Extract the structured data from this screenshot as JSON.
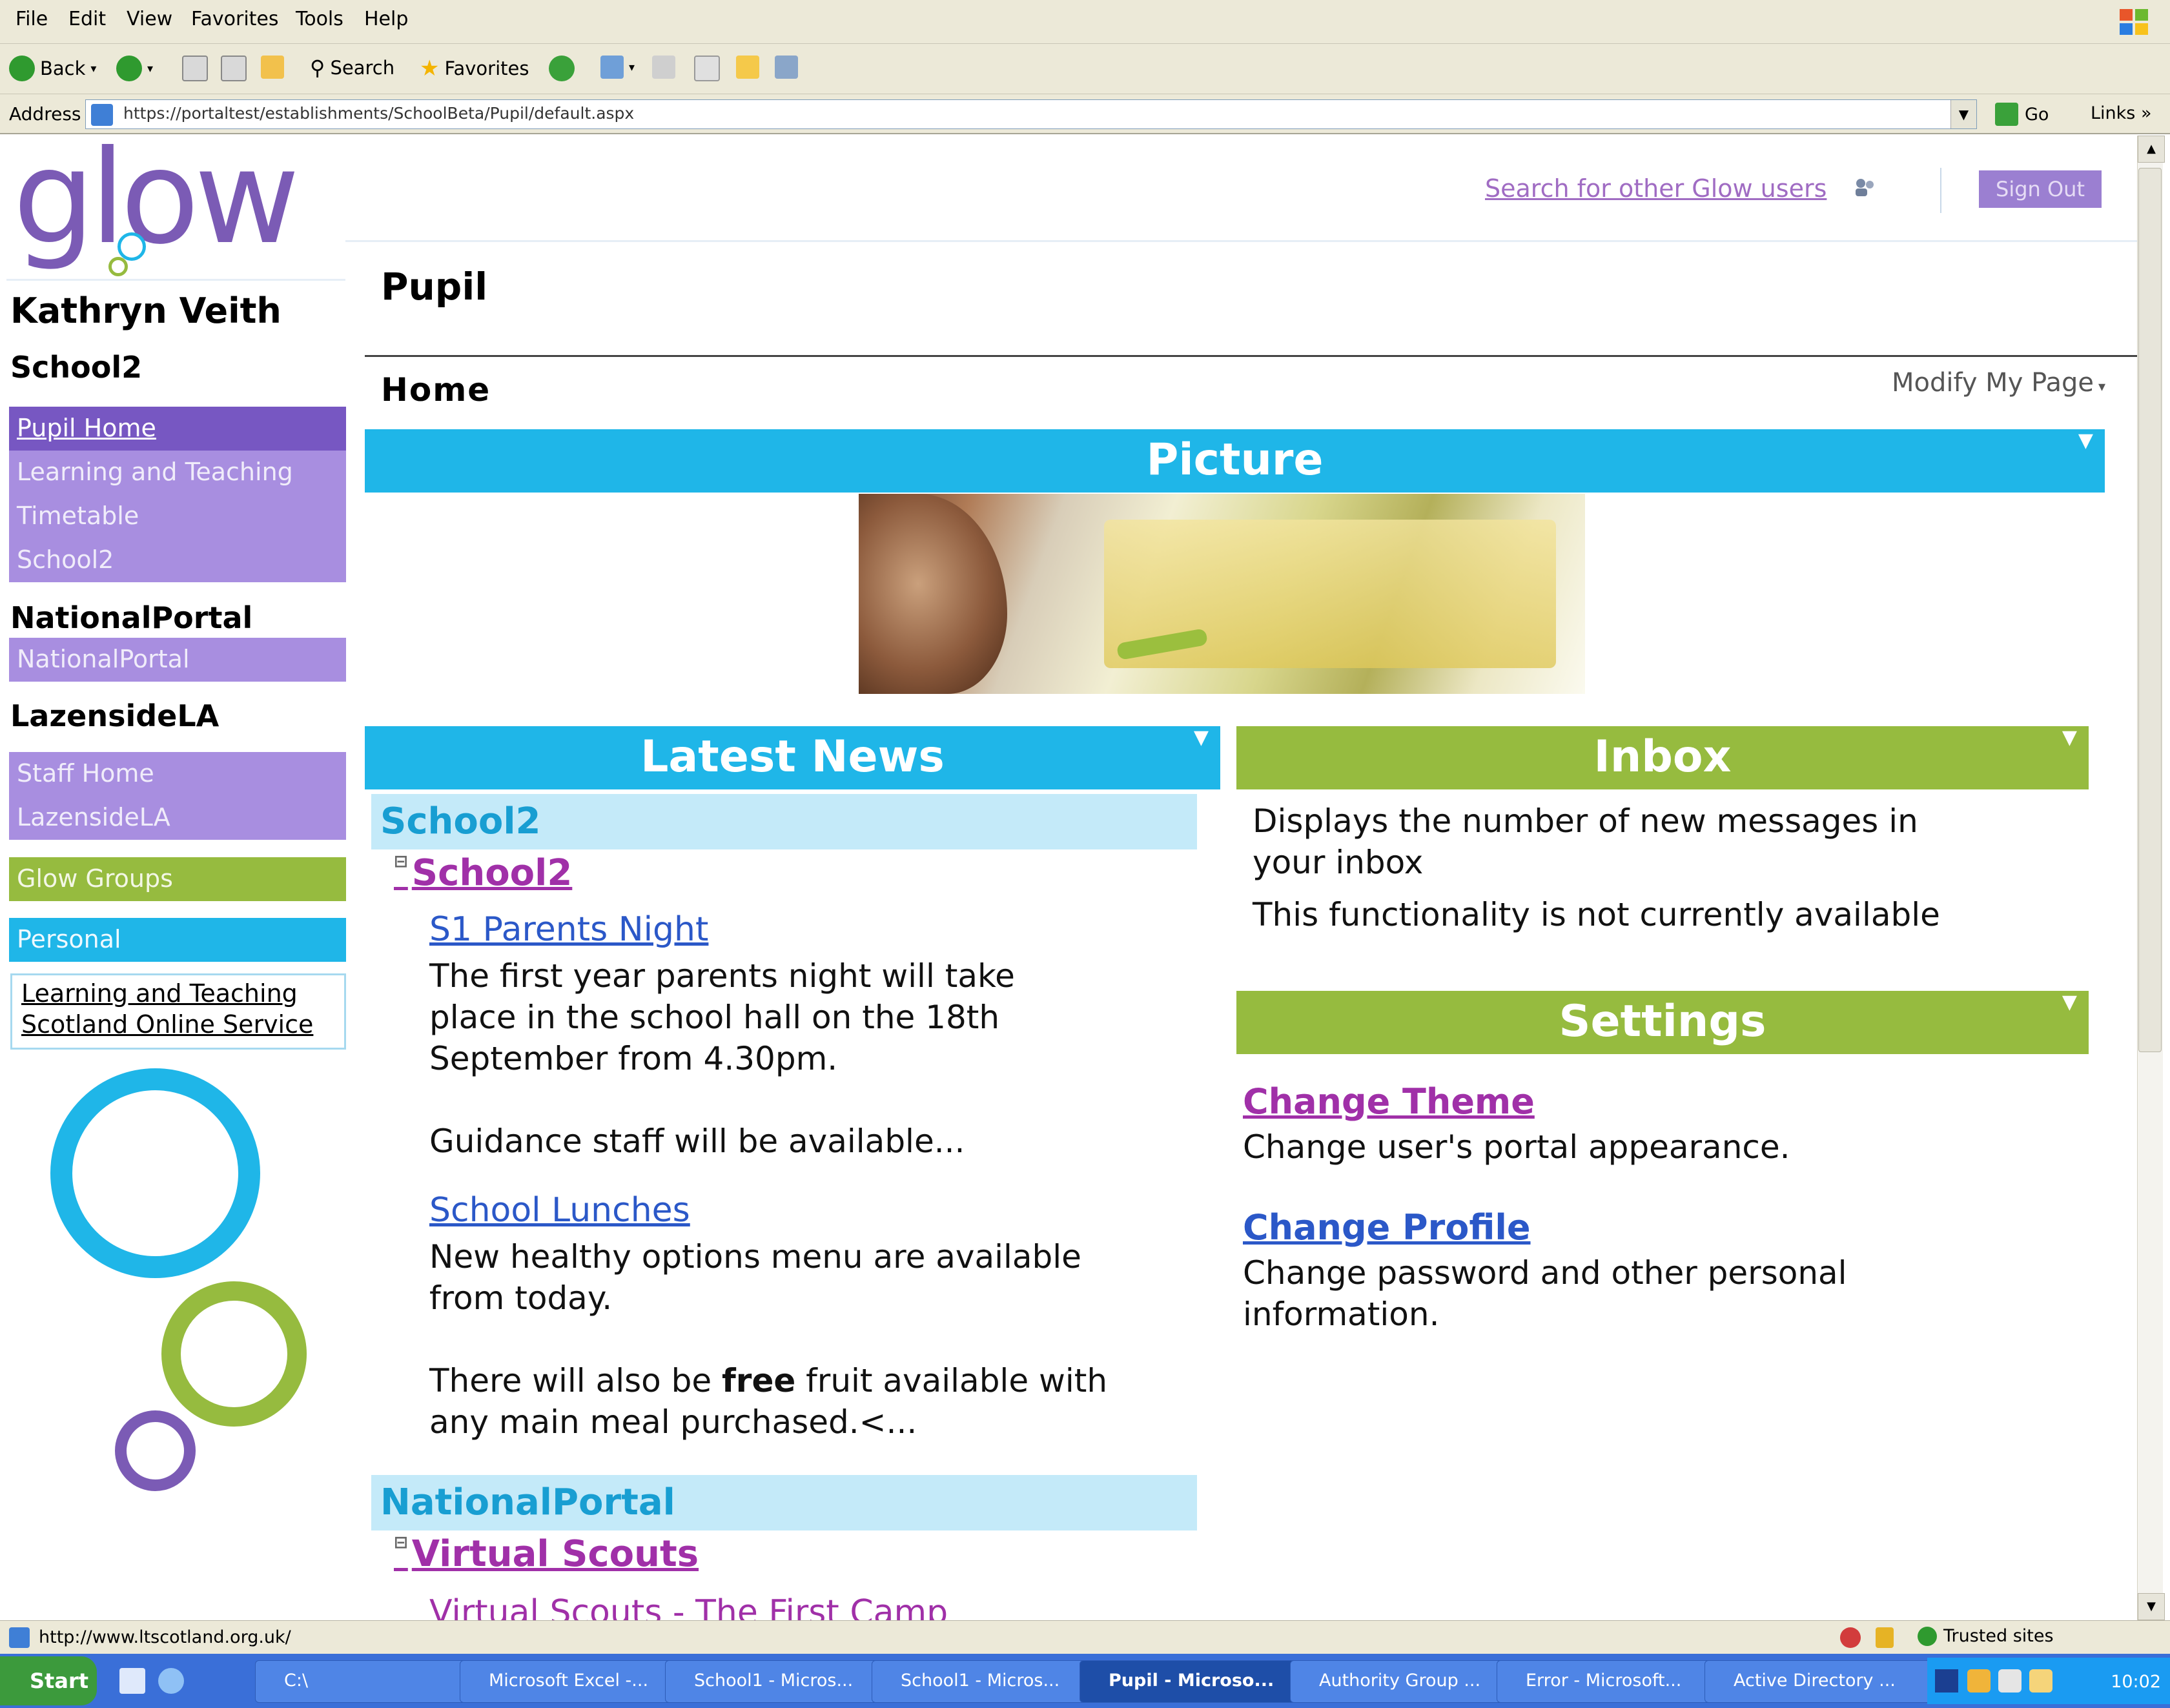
{
  "browser": {
    "menu": [
      "File",
      "Edit",
      "View",
      "Favorites",
      "Tools",
      "Help"
    ],
    "toolbar": {
      "back": "Back",
      "search": "Search",
      "favorites": "Favorites"
    },
    "address": {
      "label": "Address",
      "url": "https://portaltest/establishments/SchoolBeta/Pupil/default.aspx",
      "go": "Go",
      "links": "Links"
    },
    "status": {
      "url": "http://www.ltscotland.org.uk/",
      "zone": "Trusted sites"
    }
  },
  "header": {
    "logo": "glow",
    "search_users": "Search for other Glow users",
    "sign_out": "Sign Out"
  },
  "sidebar": {
    "user_name": "Kathryn Veith",
    "school": "School2",
    "school_items": [
      "Pupil Home",
      "Learning and Teaching",
      "Timetable",
      "School2"
    ],
    "national_heading": "NationalPortal",
    "national_items": [
      "NationalPortal"
    ],
    "la_heading": "LazensideLA",
    "la_items": [
      "Staff Home",
      "LazensideLA"
    ],
    "glow_groups": "Glow Groups",
    "personal": "Personal",
    "lts_line1": "Learning and Teaching",
    "lts_line2": "Scotland Online Service"
  },
  "main": {
    "title": "Pupil",
    "subtitle": "Home",
    "modify": "Modify My Page"
  },
  "picture": {
    "title": "Picture"
  },
  "news": {
    "title": "Latest News",
    "cat1": "School2",
    "sub1": "School2",
    "item1_title": "S1 Parents Night",
    "item1_body": [
      "The first year parents night will take",
      "place in the school hall on the 18th",
      "September from 4.30pm.",
      "",
      "Guidance staff will be available..."
    ],
    "item2_title": "School Lunches",
    "item2_body": [
      "New healthy options menu are available",
      "from today."
    ],
    "item2_extra_pre": "There will also be ",
    "item2_extra_bold": "free",
    "item2_extra_post": " fruit available with",
    "item2_extra_line2": "any main meal purchased.<...",
    "cat2": "NationalPortal",
    "sub2": "Virtual Scouts",
    "item3_title": "Virtual Scouts - The First Camp"
  },
  "inbox": {
    "title": "Inbox",
    "line1": "Displays the number of new messages in",
    "line2": "your inbox",
    "line3": "This functionality is not currently available"
  },
  "settings": {
    "title": "Settings",
    "theme_link": "Change Theme",
    "theme_desc": "Change user's portal appearance.",
    "profile_link": "Change Profile",
    "profile_desc1": "Change password and other personal",
    "profile_desc2": "information."
  },
  "taskbar": {
    "start": "Start",
    "quick": "C:\\",
    "tasks": [
      "Microsoft Excel -...",
      "School1 - Micros...",
      "School1 - Micros...",
      "Pupil - Microso...",
      "Authority Group ...",
      "Error - Microsoft...",
      "Active Directory ..."
    ],
    "clock": "10:02"
  },
  "colors": {
    "glow_purple": "#7b5bb5",
    "nav_purple": "#a88ee0",
    "nav_selected": "#7757c2",
    "glow_green": "#96bb3f",
    "glow_blue": "#1fb6e8",
    "news_category_bg": "#c4eaf9",
    "link_blue": "#2b58c8",
    "link_magenta": "#a030a8"
  }
}
